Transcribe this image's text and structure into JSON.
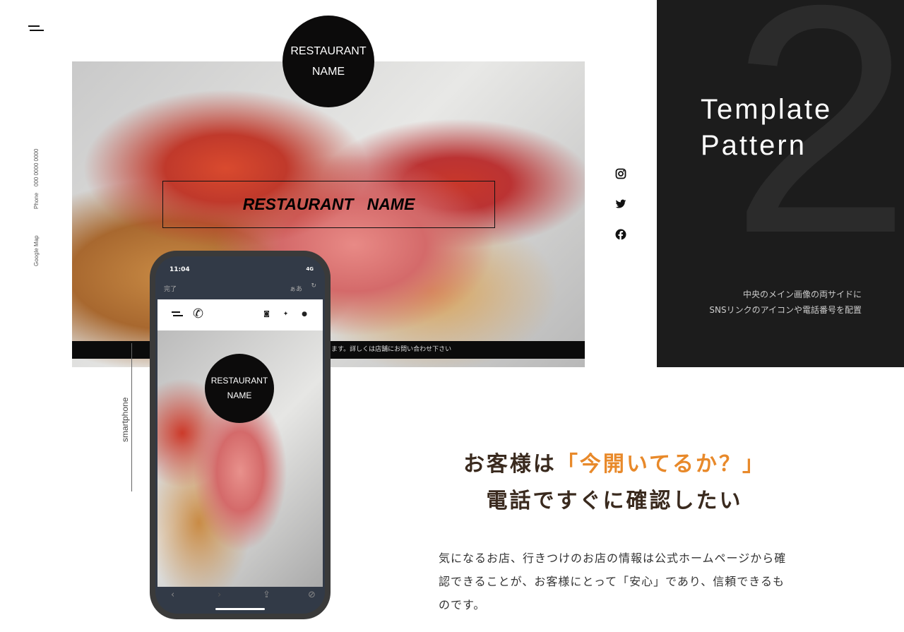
{
  "sidebar": {
    "phone_label": "Phone",
    "phone_number": "000 0000 0000",
    "map_label": "Google Map"
  },
  "hero": {
    "logo_line1": "RESTAURANT",
    "logo_line2": "NAME",
    "title": "RESTAURANT   NAME",
    "notice": "ます。詳しくは店舗にお問い合わせ下さい"
  },
  "sns": [
    "instagram-icon",
    "twitter-icon",
    "facebook-icon"
  ],
  "panel": {
    "number": "2",
    "title_line1": "Template",
    "title_line2": "Pattern",
    "caption_line1": "中央のメイン画像の両サイドに",
    "caption_line2": "SNSリンクのアイコンや電話番号を配置"
  },
  "phone": {
    "time": "11:04",
    "network": "4G",
    "done": "完了",
    "text_size": "ぁあ",
    "logo_line1": "RESTAURANT",
    "logo_line2": "NAME",
    "label": "smartphone"
  },
  "copy": {
    "heading_pre": "お客様は",
    "heading_highlight": "「今開いてるか？」",
    "heading_line2": "電話ですぐに確認したい",
    "body": "気になるお店、行きつけのお店の情報は公式ホームページから確認できることが、お客様にとって「安心」であり、信頼できるものです。"
  },
  "colors": {
    "accent": "#e8892a",
    "dark_panel": "#1c1c1c",
    "heading": "#3a2a1e"
  }
}
